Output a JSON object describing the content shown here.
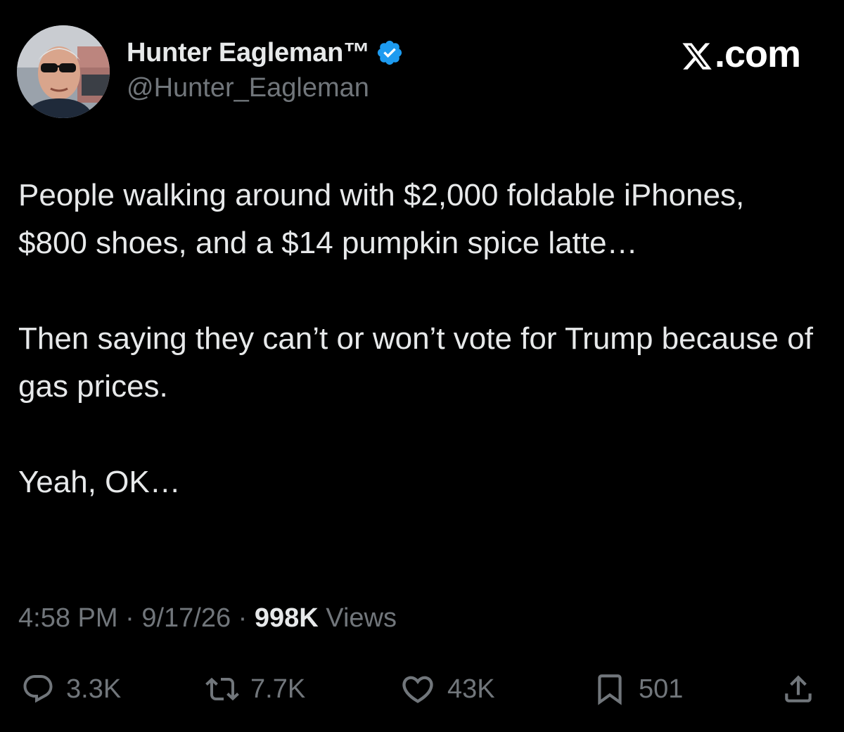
{
  "user": {
    "display_name": "Hunter Eagleman™",
    "handle": "@Hunter_Eagleman",
    "verified": true
  },
  "brand": {
    "label": ".com",
    "icon": "x-logo-icon"
  },
  "tweet": {
    "paragraphs": [
      "People walking around with $2,000 foldable iPhones, $800 shoes, and a $14 pumpkin spice latte…",
      "Then saying they can’t or won’t vote for Trump because of gas prices.",
      "Yeah, OK…"
    ]
  },
  "meta": {
    "time": "4:58 PM",
    "separator": "·",
    "date": "9/17/26",
    "views_count": "998K",
    "views_label": "Views"
  },
  "actions": {
    "replies": "3.3K",
    "reposts": "7.7K",
    "likes": "43K",
    "bookmarks": "501"
  },
  "colors": {
    "background": "#000000",
    "text": "#e7e9ea",
    "muted": "#71767b",
    "verified": "#1d9bf0"
  }
}
